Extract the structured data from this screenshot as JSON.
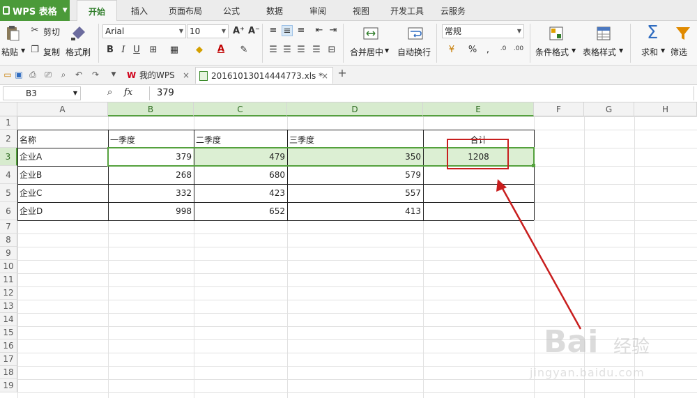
{
  "app": {
    "menu_label": "WPS 表格"
  },
  "ribbon_tabs": [
    {
      "label": "开始",
      "active": true
    },
    {
      "label": "插入"
    },
    {
      "label": "页面布局"
    },
    {
      "label": "公式"
    },
    {
      "label": "数据"
    },
    {
      "label": "审阅"
    },
    {
      "label": "视图"
    },
    {
      "label": "开发工具"
    },
    {
      "label": "云服务"
    }
  ],
  "ribbon": {
    "paste": "粘贴",
    "cut": "剪切",
    "copy": "复制",
    "format_painter": "格式刷",
    "font_name": "Arial",
    "font_size": "10",
    "merge_center": "合并居中",
    "wrap_text": "自动换行",
    "number_format": "常规",
    "conditional_format": "条件格式",
    "table_style": "表格样式",
    "sum": "求和",
    "filter": "筛选"
  },
  "doc_tabs": [
    {
      "label": "我的WPS"
    },
    {
      "label": "20161013014444773.xls *"
    }
  ],
  "formula_bar": {
    "cell_ref": "B3",
    "fx": "fx",
    "value": "379"
  },
  "columns": [
    "A",
    "B",
    "C",
    "D",
    "E",
    "F",
    "G",
    "H"
  ],
  "rows": [
    "1",
    "2",
    "3",
    "4",
    "5",
    "6",
    "7",
    "8",
    "9",
    "10",
    "11",
    "12",
    "13",
    "14",
    "15",
    "16",
    "17",
    "18",
    "19"
  ],
  "sheet": {
    "headers": [
      "名称",
      "一季度",
      "二季度",
      "三季度",
      "合计"
    ],
    "data": [
      {
        "name": "企业A",
        "q1": "379",
        "q2": "479",
        "q3": "350",
        "total": "1208"
      },
      {
        "name": "企业B",
        "q1": "268",
        "q2": "680",
        "q3": "579",
        "total": ""
      },
      {
        "name": "企业C",
        "q1": "332",
        "q2": "423",
        "q3": "557",
        "total": ""
      },
      {
        "name": "企业D",
        "q1": "998",
        "q2": "652",
        "q3": "413",
        "total": ""
      }
    ]
  },
  "colors": {
    "accent": "#4b9a39",
    "selection": "#dcefd3",
    "annotation": "#c81e1e"
  },
  "watermark": {
    "brand": "Bai",
    "brand_cn": "经验",
    "url": "jingyan.baidu.com"
  }
}
